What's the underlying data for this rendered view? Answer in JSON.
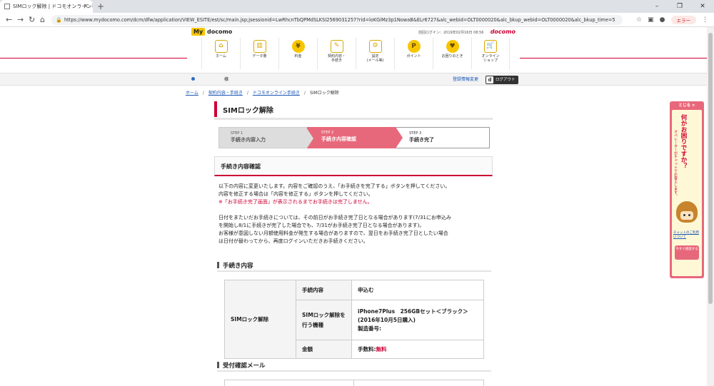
{
  "browser": {
    "tab_title": "SIMロック解除 | ドコモオンライン手続",
    "new_tab": "+",
    "url": "https://www.mydocomo.com/dcm/dfw/application/VIEW_ESITE/est/sc/main.jsp;jsessionid=LwRhcnTbQPMdSLKSI2569031257?rid=loKGiMz3p1NowaB&ELr6727&alc_webid=OLT0000020&alc_bkup_webid=OLT0000020&alc_bkup_time=5",
    "error_label": "エラー"
  },
  "header": {
    "logo_my": "My",
    "logo_text": "docomo",
    "last_login": "前回ログイン：2019年02月16日 08:56",
    "brand": "docomo",
    "nav": [
      {
        "label": "ホーム",
        "icon": "⌂"
      },
      {
        "label": "データ量",
        "icon": "▥"
      },
      {
        "label": "料金",
        "icon": "¥"
      },
      {
        "label": "契約内容・\n手続き",
        "icon": "✎"
      },
      {
        "label": "設定\n(メール等)",
        "icon": "⚙"
      },
      {
        "label": "ポイント",
        "icon": "P"
      },
      {
        "label": "お困りのとき",
        "icon": "♥"
      },
      {
        "label": "オンライン\nショップ",
        "icon": "🛒"
      }
    ]
  },
  "subbar": {
    "username": "様",
    "register_link": "登録情報変更",
    "logout_d": "d",
    "logout": "ログアウト"
  },
  "breadcrumb": {
    "home": "ホーム",
    "contract": "契約内容・手続き",
    "online": "ドコモオンライン手続き",
    "current": "SIMロック解除"
  },
  "page": {
    "title": "SIMロック解除",
    "steps": [
      {
        "num": "STEP 1",
        "label": "手続き内容入力"
      },
      {
        "num": "STEP 2",
        "label": "手続き内容確認"
      },
      {
        "num": "STEP 3",
        "label": "手続き完了"
      }
    ],
    "section_title": "手続き内容確認",
    "para1_line1": "以下の内容に変更いたします。内容をご確認のうえ、「お手続きを完了する」ボタンを押してください。",
    "para1_line2": "内容を修正する場合は「内容を修正する」ボタンを押してください。",
    "warning": "※「お手続き完了画面」が表示されるまでお手続きは完了しません。",
    "para2_line1": "日付をまたいだお手続きについては、その前日がお手続き完了日となる場合があります(7/31にお申込み",
    "para2_line2": "を開始し8/1に手続きが完了した場合でも、7/31がお手続き完了日となる場合があります)。",
    "para2_line3": "お客様が意図しない月額使用料金が発生する場合がありますので、翌日をお手続き完了日としたい場合",
    "para2_line4": "は日付が替わってから、再度ログインいただきお手続きください。",
    "details_heading": "手続き内容",
    "table": {
      "row_header": "SIMロック解除",
      "procedure_label": "手続内容",
      "procedure_value": "申込む",
      "device_label": "SIMロック解除を行う機種",
      "device_value": "iPhone7Plus　256GBセット＜ブラック＞(2016年10月5日購入)",
      "serial_label": "製造番号:",
      "amount_label": "金額",
      "fee_label": "手数料:",
      "fee_value": "無料"
    },
    "mail_heading": "受付確認メール"
  },
  "chat": {
    "close": "とじる ×",
    "headline": "何かお困りですか？",
    "sub": "オペレーターがチャットでお答えします。",
    "link": "チャットのご利用について",
    "button": "今すぐ相談する"
  }
}
